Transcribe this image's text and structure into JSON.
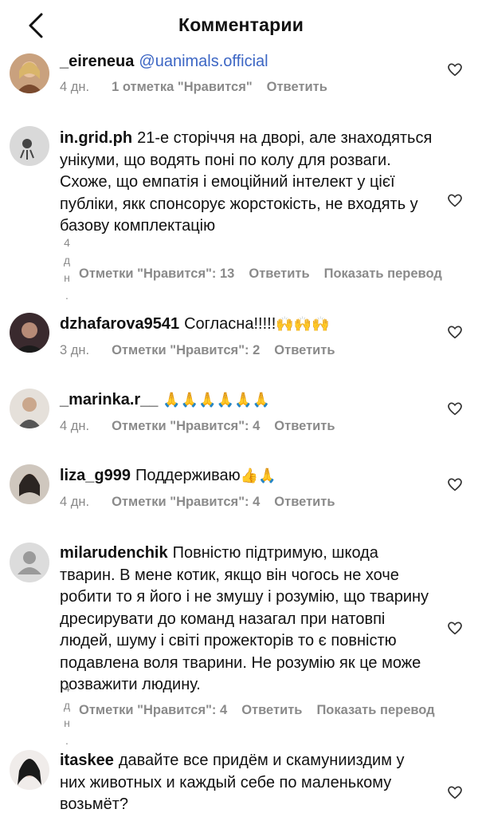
{
  "header": {
    "title": "Комментарии"
  },
  "comments": [
    {
      "user": "_eireneua",
      "text_mention": "@uanimals.official",
      "date": "4 дн.",
      "likes": "1 отметка \"Нравится\"",
      "reply": "Ответить"
    },
    {
      "user": "in.grid.ph",
      "text": "21-е сторіччя на дворі, але знаходяться унікуми, що водять поні по колу для розваги. Схоже, що емпатія і емоційний інтелект у цієї публіки, якк спонсорує жорстокість, не входять у базову комплектацію",
      "date_vertical": "4 д н .",
      "likes": "Отметки \"Нравится\": 13",
      "reply": "Ответить",
      "translate": "Показать перевод"
    },
    {
      "user": "dzhafarova9541",
      "text": "Согласна!!!!!",
      "emoji": "🙌🙌🙌",
      "date": "3 дн.",
      "likes": "Отметки \"Нравится\": 2",
      "reply": "Ответить"
    },
    {
      "user": "_marinka.r__",
      "emoji": "🙏🙏🙏🙏🙏🙏",
      "date": "4 дн.",
      "likes": "Отметки \"Нравится\": 4",
      "reply": "Ответить"
    },
    {
      "user": "liza_g999",
      "text": "Поддерживаю",
      "emoji": "👍🙏",
      "date": "4 дн.",
      "likes": "Отметки \"Нравится\": 4",
      "reply": "Ответить"
    },
    {
      "user": "milarudenchik",
      "text": "Повністю підтримую, шкода тварин. В мене котик, якщо він чогось не хоче робити то я його і не змушу і розумію, що тварину дресирувати до команд назагал при натовпі людей, шуму і світі прожекторів то є повністю подавлена воля тварини. Не розумію як це може розважити людину.",
      "date_vertical": "4 д н .",
      "likes": "Отметки \"Нравится\": 4",
      "reply": "Ответить",
      "translate": "Показать перевод"
    },
    {
      "user": "itaskee",
      "text": "давайте все придём и скамунииздим у них животных и каждый себе по маленькому возьмёт?"
    }
  ],
  "icons": {
    "back": "chevron-left-icon",
    "like": "heart-outline-icon"
  },
  "colors": {
    "mention": "#3c66c4",
    "meta": "#8a8a8a"
  }
}
